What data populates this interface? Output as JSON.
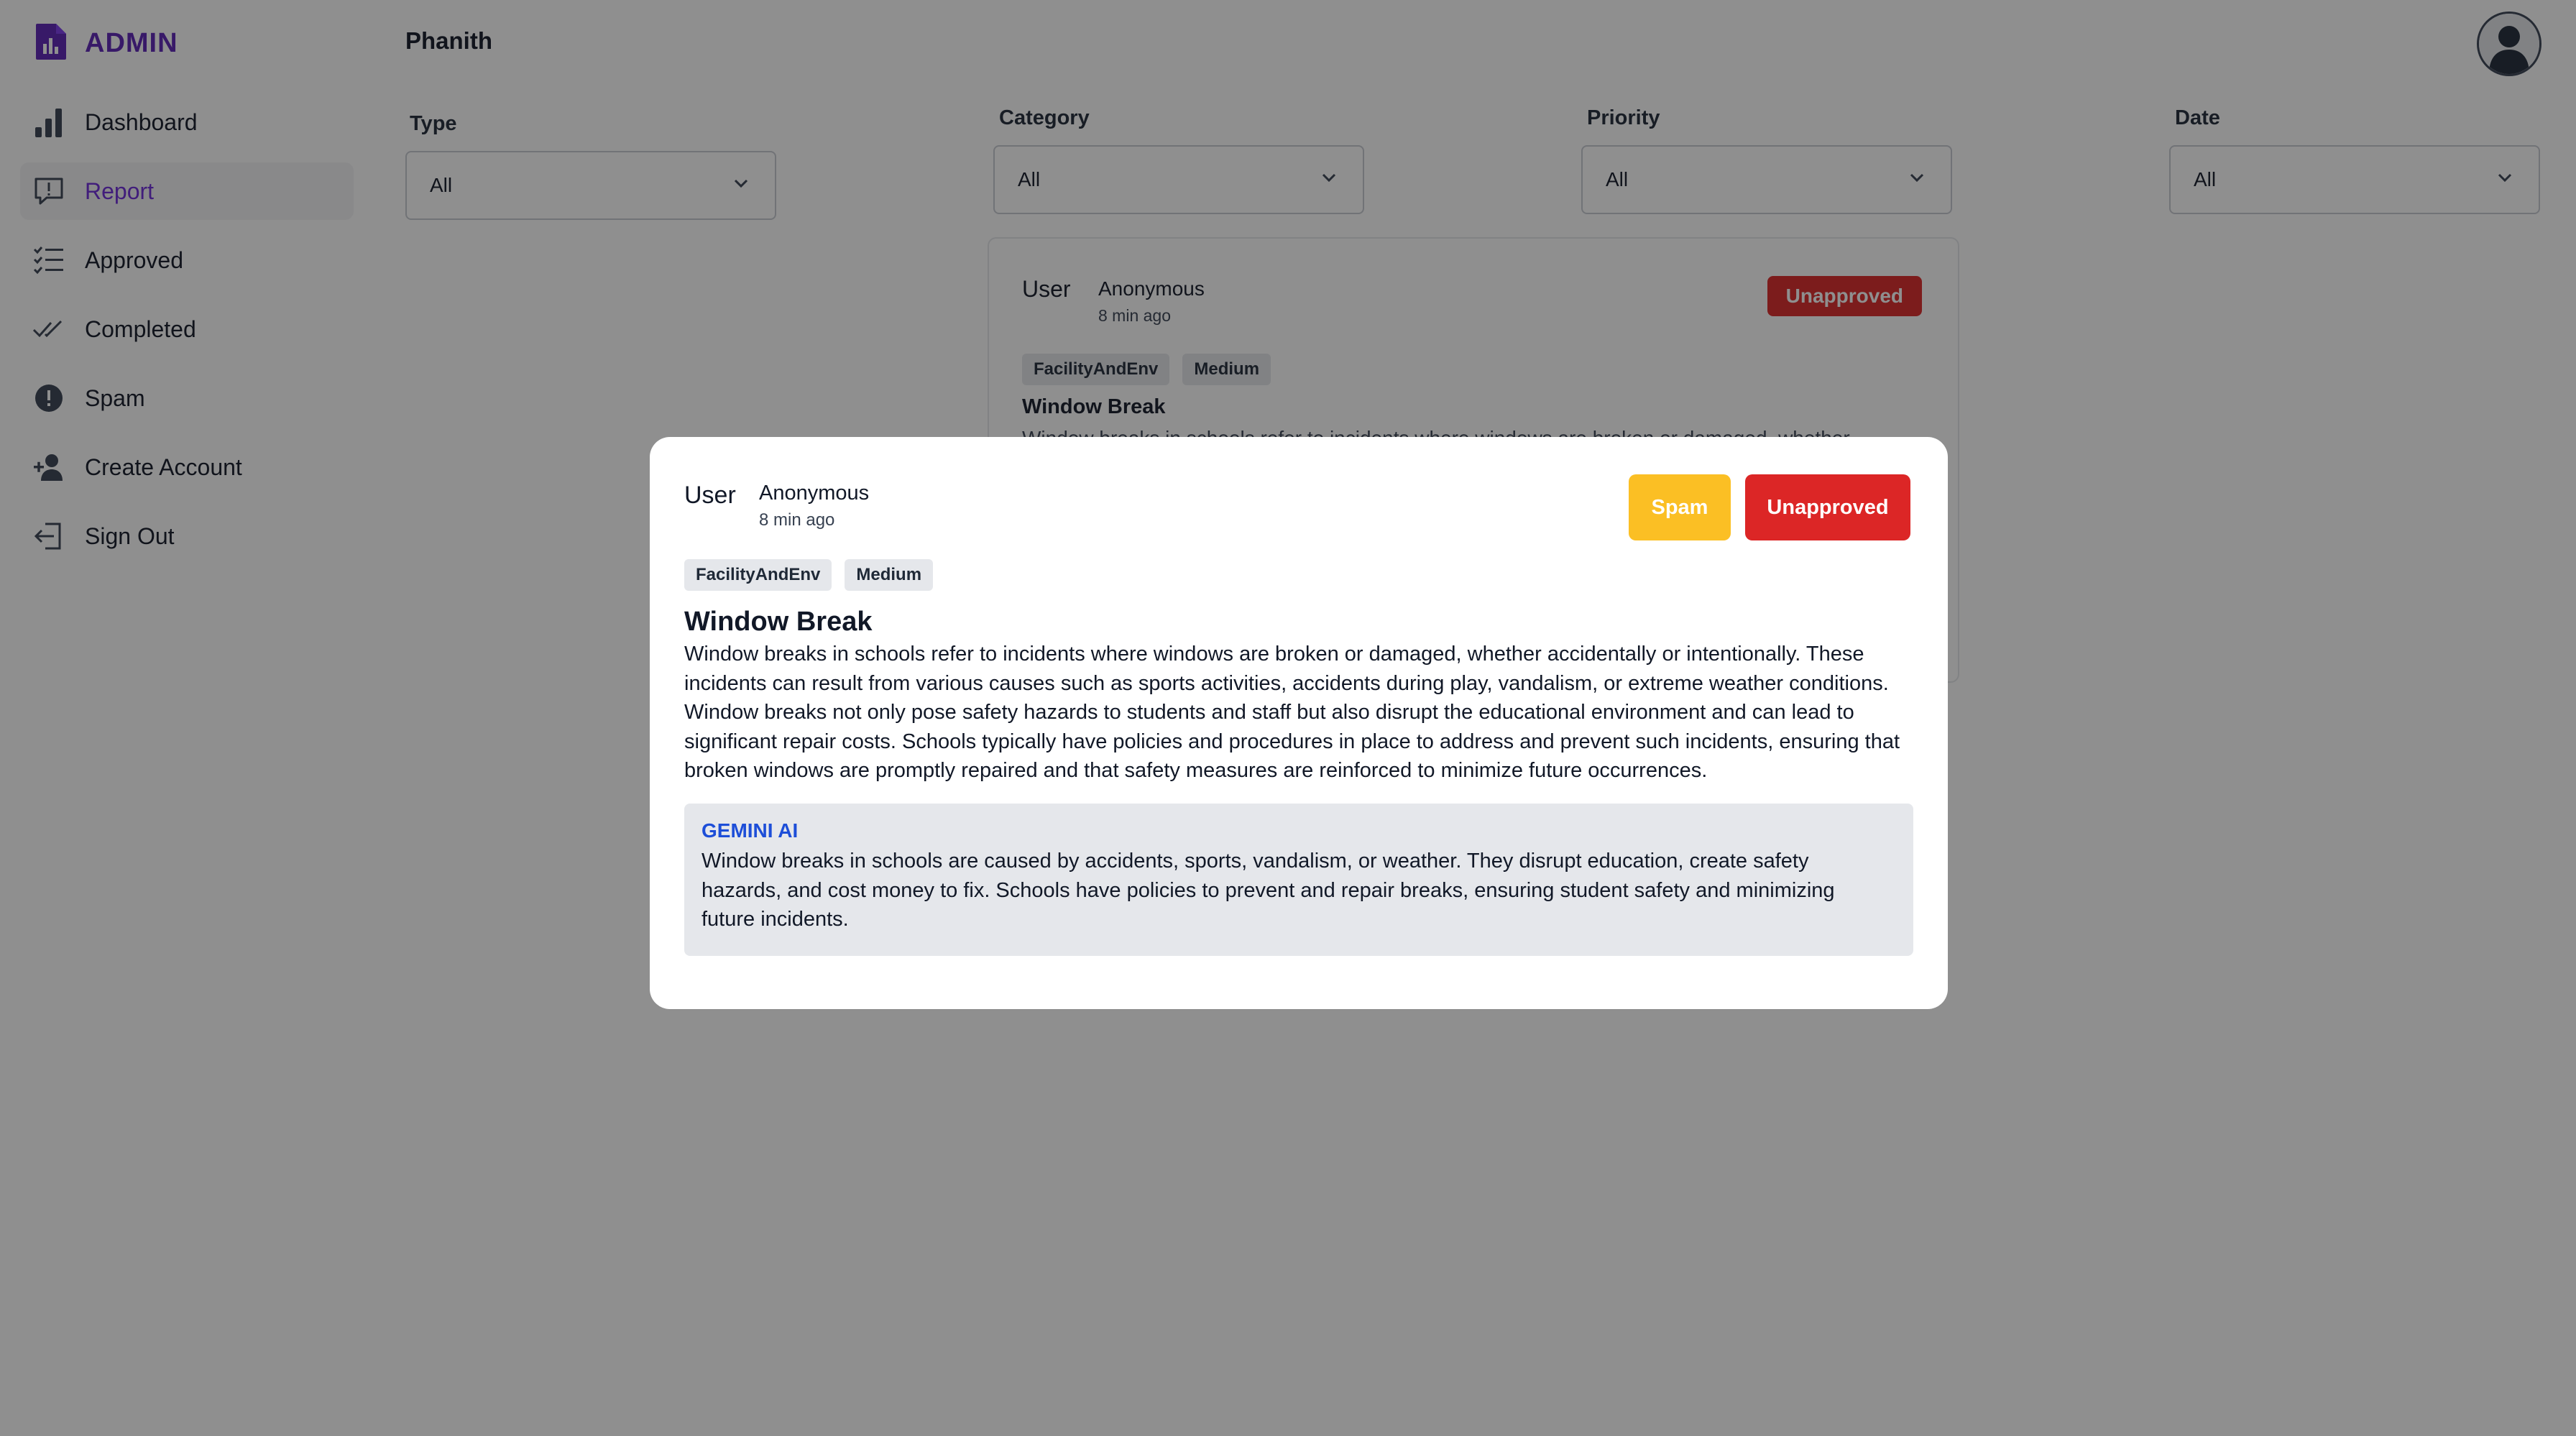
{
  "brand": {
    "name": "ADMIN",
    "icon": "document-chart-icon",
    "color": "#5b21b6"
  },
  "sidebar": {
    "items": [
      {
        "label": "Dashboard",
        "icon": "chart-bar-icon",
        "active": false
      },
      {
        "label": "Report",
        "icon": "report-icon",
        "active": true
      },
      {
        "label": "Approved",
        "icon": "checklist-icon",
        "active": false
      },
      {
        "label": "Completed",
        "icon": "double-check-icon",
        "active": false
      },
      {
        "label": "Spam",
        "icon": "alert-circle-icon",
        "active": false
      },
      {
        "label": "Create Account",
        "icon": "add-user-icon",
        "active": false
      },
      {
        "label": "Sign Out",
        "icon": "sign-out-icon",
        "active": false
      }
    ]
  },
  "header": {
    "user_name": "Phanith",
    "avatar_icon": "user-avatar-icon"
  },
  "filters": {
    "type": {
      "label": "Type",
      "value": "All"
    },
    "category": {
      "label": "Category",
      "value": "All"
    },
    "priority": {
      "label": "Priority",
      "value": "All"
    },
    "date": {
      "label": "Date",
      "value": "All"
    }
  },
  "report_card": {
    "image_alt": "User",
    "user": "Anonymous",
    "time": "8 min ago",
    "status": "Unapproved",
    "tags": [
      "FacilityAndEnv",
      "Medium"
    ],
    "title": "Window Break",
    "description_preview": "Window breaks in schools refer to incidents where windows are broken or damaged, whether"
  },
  "modal": {
    "image_alt": "User",
    "user": "Anonymous",
    "time": "8 min ago",
    "spam_label": "Spam",
    "status_label": "Unapproved",
    "tags": [
      "FacilityAndEnv",
      "Medium"
    ],
    "title": "Window Break",
    "description": "Window breaks in schools refer to incidents where windows are broken or damaged, whether accidentally or intentionally. These incidents can result from various causes such as sports activities, accidents during play, vandalism, or extreme weather conditions. Window breaks not only pose safety hazards to students and staff but also disrupt the educational environment and can lead to significant repair costs. Schools typically have policies and procedures in place to address and prevent such incidents, ensuring that broken windows are promptly repaired and that safety measures are reinforced to minimize future occurrences.",
    "ai": {
      "label": "GEMINI AI",
      "summary": "Window breaks in schools are caused by accidents, sports, vandalism, or weather. They disrupt education, create safety hazards, and cost money to fix. Schools have policies to prevent and repair breaks, ensuring student safety and minimizing future incidents."
    }
  },
  "colors": {
    "accent": "#6d28d9",
    "danger": "#dc2626",
    "warning": "#fbbf24",
    "ai_label": "#1d4ed8"
  }
}
